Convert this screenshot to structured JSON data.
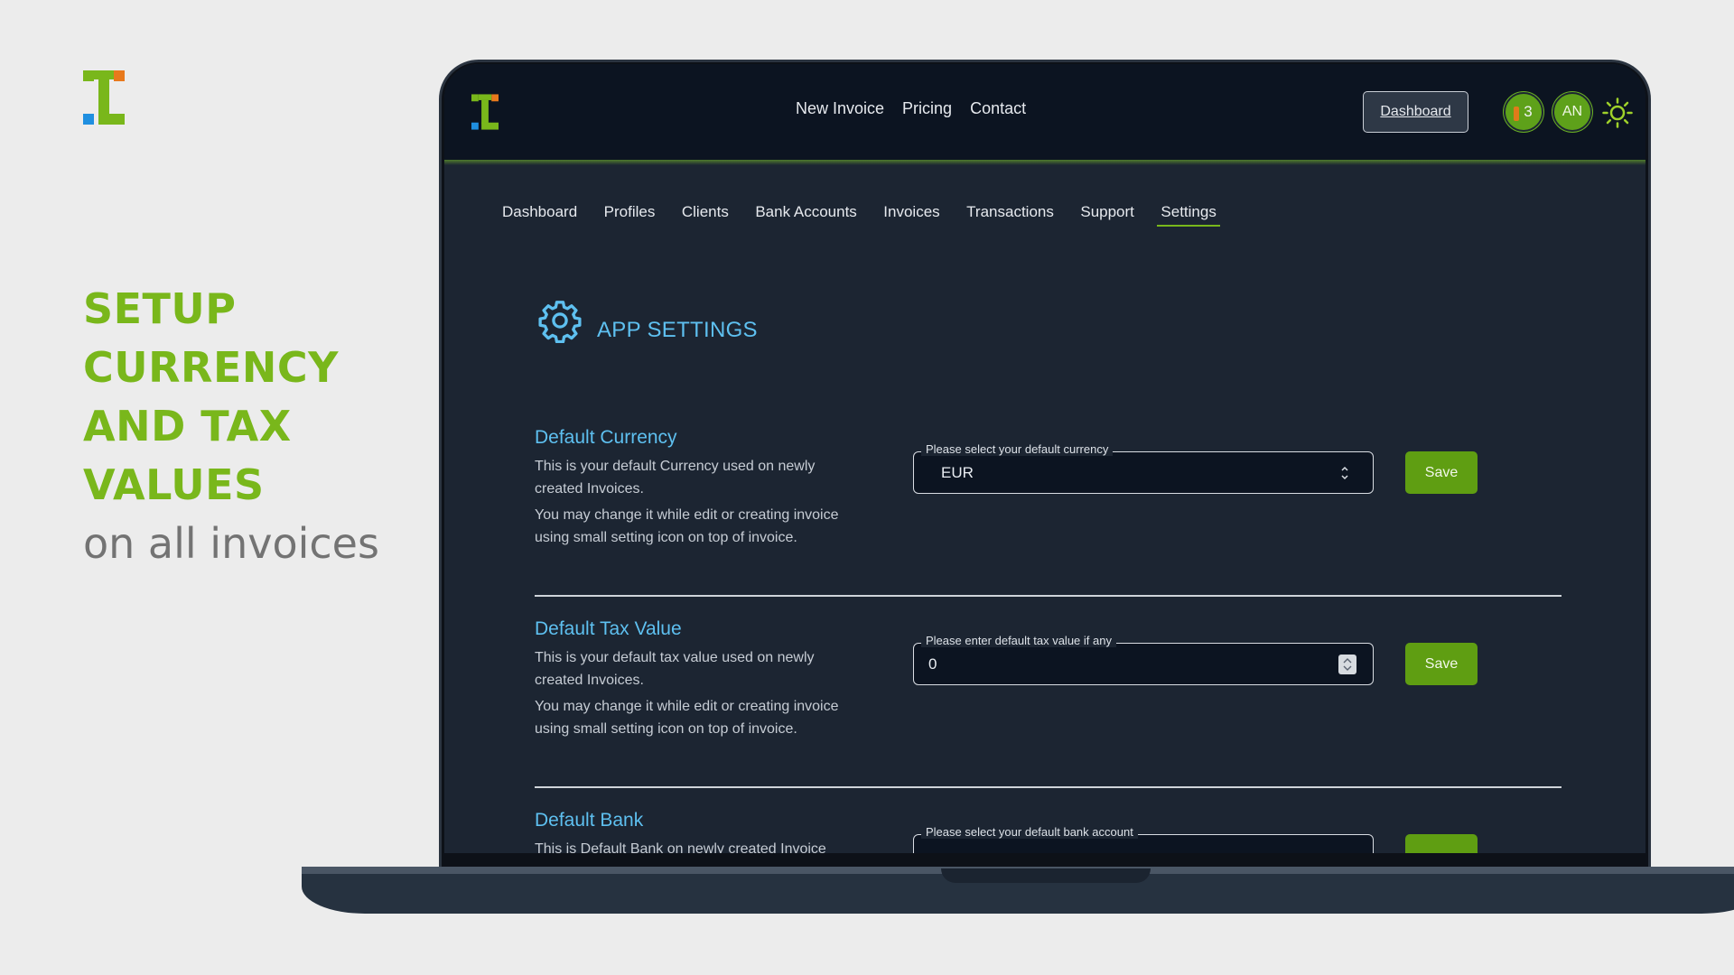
{
  "promo": {
    "headline": [
      "SETUP",
      "CURRENCY",
      "AND TAX",
      "VALUES"
    ],
    "subline": "on all invoices"
  },
  "topnav": {
    "links": [
      "New Invoice",
      "Pricing",
      "Contact"
    ],
    "dashboard_button": "Dashboard",
    "notification_count": "3",
    "avatar_initials": "AN"
  },
  "subnav": {
    "items": [
      "Dashboard",
      "Profiles",
      "Clients",
      "Bank Accounts",
      "Invoices",
      "Transactions",
      "Support",
      "Settings"
    ],
    "active": "Settings"
  },
  "page": {
    "title": "APP SETTINGS"
  },
  "sections": [
    {
      "title": "Default Currency",
      "desc1": "This is your default Currency used on newly created Invoices.",
      "desc2": "You may change it while edit or creating invoice using small setting icon on top of invoice.",
      "field_label": "Please select your default currency",
      "field_value": "EUR",
      "save": "Save"
    },
    {
      "title": "Default Tax Value",
      "desc1": "This is your default tax value used on newly created Invoices.",
      "desc2": "You may change it while edit or creating invoice using small setting icon on top of invoice.",
      "field_label": "Please enter default tax value if any",
      "field_value": "0",
      "save": "Save"
    },
    {
      "title": "Default Bank",
      "desc1": "This is Default Bank on newly created Invoice",
      "field_label": "Please select your default bank account"
    }
  ],
  "colors": {
    "brand_green": "#79b71b",
    "accent_blue": "#5ec0f0",
    "save_green": "#5f9e12",
    "logo_orange": "#e8791c",
    "logo_blue": "#1f8fe0"
  },
  "icons": [
    "brand-logo-icon",
    "bell-icon",
    "sun-icon",
    "gear-icon",
    "select-caret-icon",
    "number-spinner-icon"
  ]
}
